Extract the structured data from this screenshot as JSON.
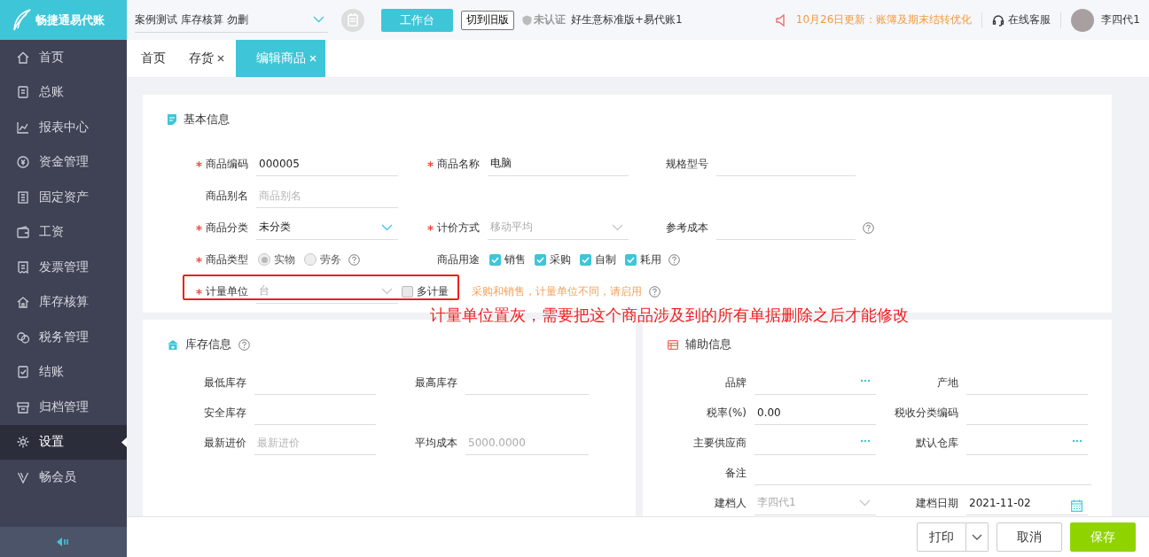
{
  "logo": {
    "text": "畅捷通易代账"
  },
  "sidebar": {
    "items": [
      {
        "label": "首页",
        "selected": false
      },
      {
        "label": "总账",
        "selected": false
      },
      {
        "label": "报表中心",
        "selected": false
      },
      {
        "label": "资金管理",
        "selected": false
      },
      {
        "label": "固定资产",
        "selected": false
      },
      {
        "label": "工资",
        "selected": false
      },
      {
        "label": "发票管理",
        "selected": false
      },
      {
        "label": "库存核算",
        "selected": false
      },
      {
        "label": "税务管理",
        "selected": false
      },
      {
        "label": "结账",
        "selected": false
      },
      {
        "label": "归档管理",
        "selected": false
      },
      {
        "label": "设置",
        "selected": true
      },
      {
        "label": "畅会员",
        "selected": false
      }
    ]
  },
  "topbar": {
    "account_select": "案例测试 库存核算 勿删",
    "workbench_button": "工作台",
    "old_version_button": "切到旧版",
    "cert_status": "未认证",
    "edition": "好生意标准版+易代账1",
    "notice": "10月26日更新：账簿及期末结转优化",
    "support": "在线客服",
    "user": "李四代1"
  },
  "tabs": [
    {
      "label": "首页",
      "selected": false,
      "closable": false
    },
    {
      "label": "存货",
      "selected": false,
      "closable": true
    },
    {
      "label": "编辑商品",
      "selected": true,
      "closable": true
    }
  ],
  "basic_info": {
    "title": "基本信息",
    "rows": [
      [
        {
          "label": "商品编码",
          "required": true,
          "kind": "text",
          "value": "000005"
        },
        {
          "label": "商品名称",
          "required": true,
          "kind": "text",
          "value": "电脑"
        },
        {
          "label": "规格型号",
          "required": false,
          "kind": "text"
        }
      ],
      [
        {
          "label": "商品别名",
          "required": false,
          "kind": "text",
          "placeholder": "商品别名"
        }
      ],
      [
        {
          "label": "商品分类",
          "required": true,
          "kind": "select",
          "value": "未分类"
        },
        {
          "label": "计价方式",
          "required": true,
          "kind": "select",
          "value": "移动平均",
          "disabled": true
        },
        {
          "label": "参考成本",
          "required": false,
          "kind": "text",
          "help": true
        }
      ],
      [
        {
          "label": "商品类型",
          "required": true,
          "kind": "radio",
          "disabled": true,
          "help": true,
          "options": [
            {
              "label": "实物",
              "selected": true
            },
            {
              "label": "劳务",
              "selected": false
            }
          ]
        },
        {
          "label": "商品用途",
          "required": false,
          "kind": "checks",
          "help": true,
          "options": [
            {
              "label": "销售",
              "checked": true
            },
            {
              "label": "采购",
              "checked": true
            },
            {
              "label": "自制",
              "checked": true
            },
            {
              "label": "耗用",
              "checked": true
            }
          ]
        }
      ],
      [
        {
          "label": "计量单位",
          "required": true,
          "kind": "select",
          "value": "台",
          "disabled": true,
          "multi": {
            "label": "多计量",
            "checked": false
          },
          "hint": "采购和销售，计量单位不同，请启用",
          "help": true
        }
      ]
    ]
  },
  "stock_info": {
    "title": "库存信息",
    "help": true,
    "rows": [
      [
        {
          "label": "最低库存",
          "kind": "text"
        },
        {
          "label": "最高库存",
          "kind": "text"
        }
      ],
      [
        {
          "label": "安全库存",
          "kind": "text"
        }
      ],
      [
        {
          "label": "最新进价",
          "kind": "text",
          "placeholder": "最新进价"
        },
        {
          "label": "平均成本",
          "kind": "text",
          "value": "5000.0000",
          "disabled": true
        }
      ]
    ]
  },
  "aux_info": {
    "title": "辅助信息",
    "rows": [
      [
        {
          "label": "品牌",
          "kind": "lookup"
        },
        {
          "label": "产地",
          "kind": "text"
        }
      ],
      [
        {
          "label": "税率(%)",
          "kind": "text",
          "value": "0.00"
        },
        {
          "label": "税收分类编码",
          "kind": "text"
        }
      ],
      [
        {
          "label": "主要供应商",
          "kind": "lookup"
        },
        {
          "label": "默认仓库",
          "kind": "lookup"
        }
      ],
      [
        {
          "label": "备注",
          "kind": "text",
          "wide": true
        }
      ],
      [
        {
          "label": "建档人",
          "kind": "select",
          "value": "李四代1",
          "disabled": true
        },
        {
          "label": "建档日期",
          "kind": "date",
          "value": "2021-11-02"
        }
      ]
    ]
  },
  "footer": {
    "print_button": "打印",
    "cancel_button": "取消",
    "save_button": "保存"
  },
  "annotation": {
    "text": "计量单位置灰，需要把这个商品涉及到的所有单据删除之后才能修改"
  }
}
